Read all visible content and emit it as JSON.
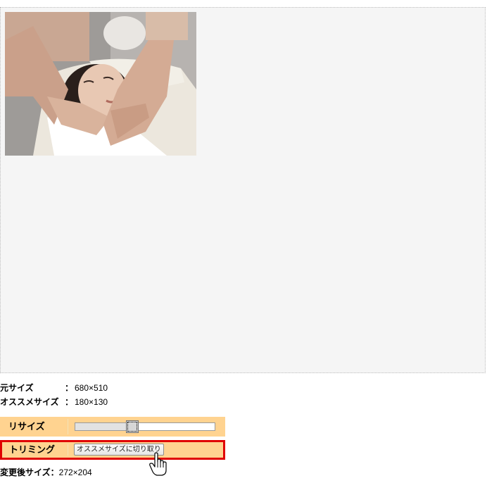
{
  "preview": {
    "image_alt": "Facial massage photo"
  },
  "info": {
    "original_size_label": "元サイズ",
    "original_size_sep": "：",
    "original_size_value": "680×510",
    "recommended_size_label": "オススメサイズ",
    "recommended_size_sep": "：",
    "recommended_size_value": "180×130"
  },
  "resize": {
    "label": "リサイズ",
    "slider_value_fraction": 0.4
  },
  "trimming": {
    "label": "トリミング",
    "button_label": "オススメサイズに切り取り"
  },
  "result": {
    "label": "変更後サイズ",
    "sep": "：",
    "value": "272×204"
  },
  "colors": {
    "row_background": "#ffd390",
    "highlight_border": "#e00000",
    "canvas_background": "#f5f5f5"
  },
  "icons": [
    "hand-pointer-cursor-icon"
  ]
}
